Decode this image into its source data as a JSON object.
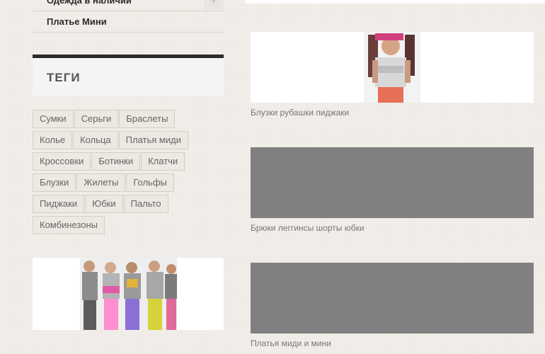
{
  "sidebar": {
    "menu": [
      {
        "label": "Одежда в наличии"
      },
      {
        "label": "Платье Мини"
      }
    ],
    "expand_symbol": "+",
    "tags_widget": {
      "title": "ТЕГИ",
      "rows": [
        [
          "Сумки",
          "Серьги",
          "Браслеты"
        ],
        [
          "Колье",
          "Кольца",
          "Платья миди"
        ],
        [
          "Кроссовки",
          "Ботинки",
          "Клатчи"
        ],
        [
          "Блузки",
          "Жилеты",
          "Гольфы"
        ],
        [
          "Пиджаки",
          "Юбки",
          "Пальто"
        ],
        [
          "Комбинезоны"
        ]
      ]
    }
  },
  "posts": [
    {
      "caption": "Блузки рубашки пиджаки"
    },
    {
      "caption": "Брюки леггинсы шорты юбки"
    },
    {
      "caption": "Платья миди и мини"
    }
  ],
  "colors": {
    "page_bg": "#f1ede8",
    "widget_border": "#2b2b2b",
    "placeholder_gray": "#808080"
  }
}
